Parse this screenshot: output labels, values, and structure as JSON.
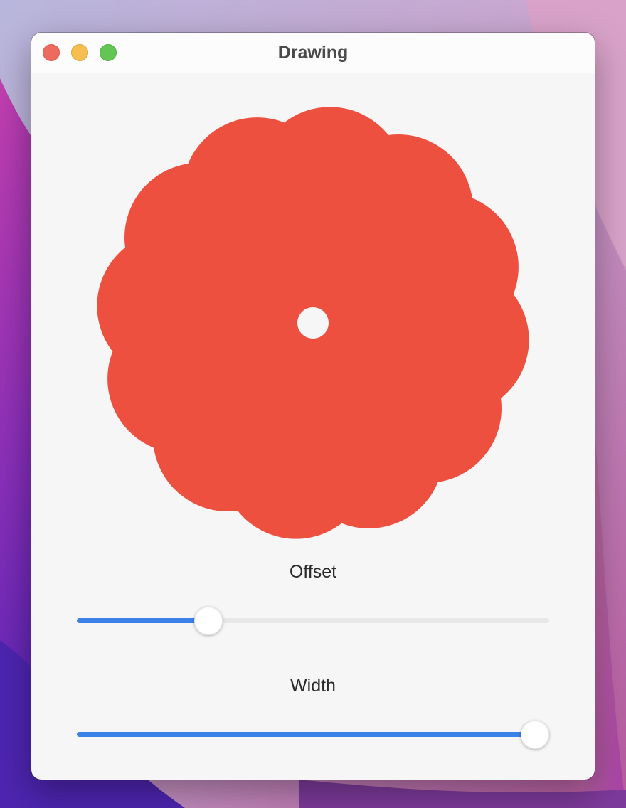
{
  "window": {
    "title": "Drawing",
    "controls": [
      "close",
      "minimize",
      "zoom"
    ]
  },
  "drawing": {
    "shape_color": "#ee5040",
    "background_color": "#f6f6f7",
    "petals": 12
  },
  "controls": {
    "offset": {
      "label": "Offset",
      "value": 0.265
    },
    "width": {
      "label": "Width",
      "value": 1.0
    }
  },
  "colors": {
    "accent": "#3a82e8",
    "close": "#ee6a5f",
    "minimize": "#f5be4f",
    "zoom": "#62c554"
  }
}
